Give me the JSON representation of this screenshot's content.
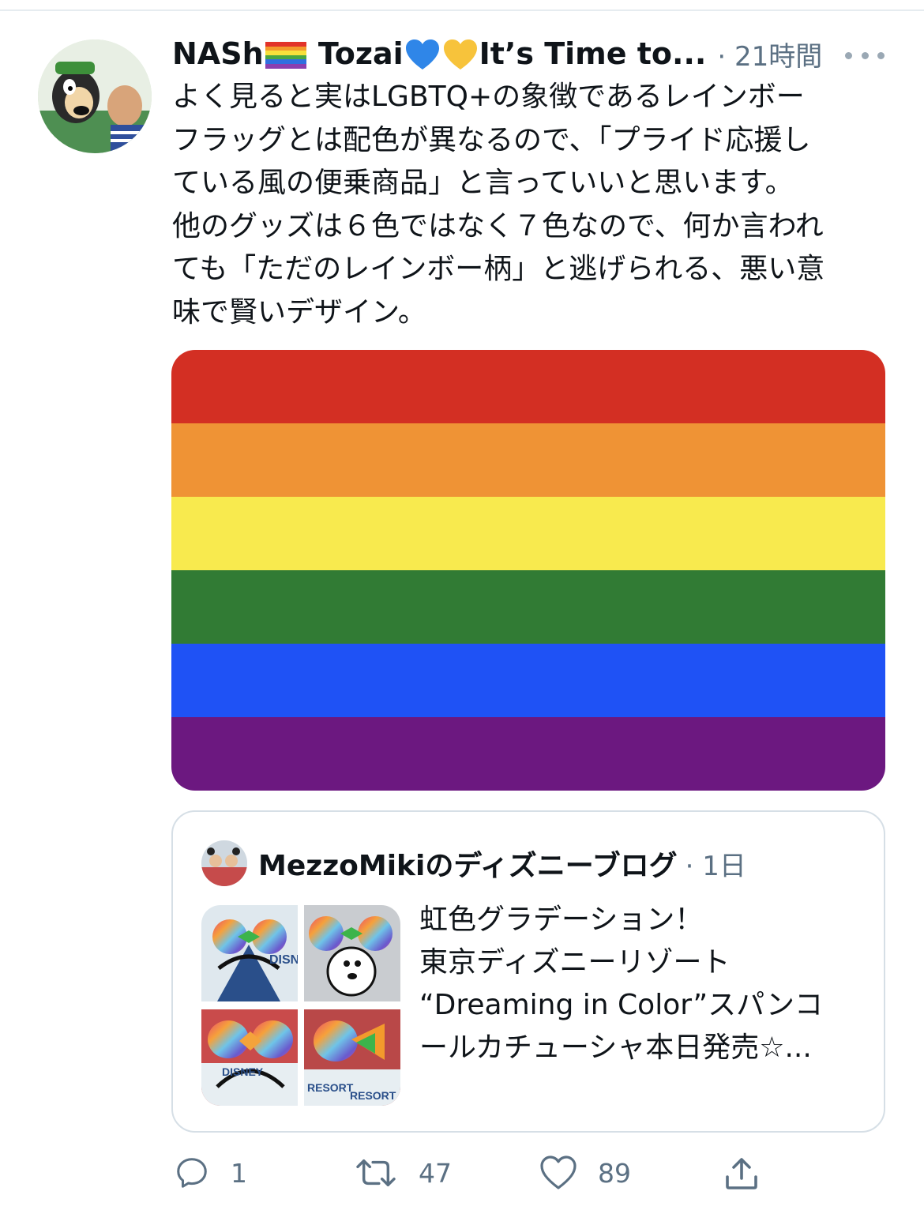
{
  "tweet": {
    "display_name_parts": [
      "NASh",
      " Tozai",
      "It’s Time to..."
    ],
    "separator": "·",
    "timestamp": "21時間",
    "text": "よく見ると実はLGBTQ+の象徴であるレインボー\nフラッグとは配色が異なるので、「プライド応援し\nている風の便乗商品」と言っていいと思います。\n他のグッズは６色ではなく７色なので、何か言われ\nても「ただのレインボー柄」と逃げられる、悪い意\n味で賢いデザイン。"
  },
  "flag_colors": [
    "#d32f23",
    "#ef9335",
    "#f8ea4e",
    "#317b34",
    "#1f52f5",
    "#6c1880"
  ],
  "quoted": {
    "account_name": "MezzoMikiのディズニーブログ",
    "separator": "·",
    "timestamp": "1日",
    "text": "虹色グラデーション！\n東京ディズニーリゾート\n“Dreaming in Color”スパンコ\nールカチューシャ本日発売☆...",
    "thumbnail_texts": [
      "DISNEY",
      "RESORT",
      "DISNEY",
      "RESORT"
    ]
  },
  "actions": {
    "reply_count": "1",
    "retweet_count": "47",
    "like_count": "89"
  },
  "colors": {
    "text": "#0f1419",
    "muted": "#5b7083",
    "border": "#d6dfe6"
  }
}
